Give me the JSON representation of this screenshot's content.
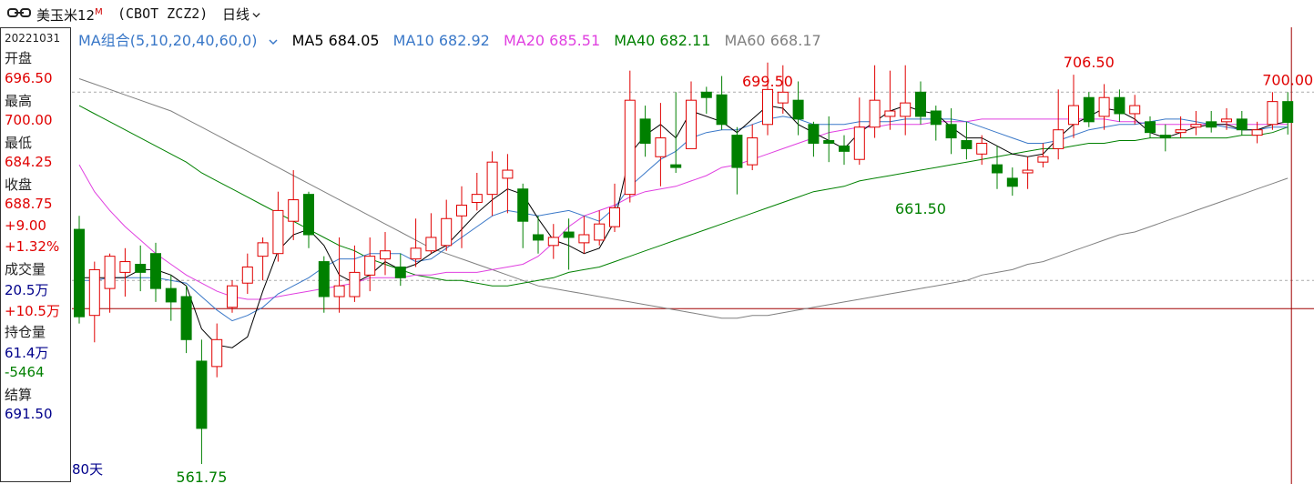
{
  "header": {
    "symbol_name": "美玉米12",
    "symbol_badge": "M",
    "code": "(CBOT ZCZ2)",
    "period_label": "日线"
  },
  "info": {
    "date": "20221031",
    "open_label": "开盘",
    "open": "696.50",
    "high_label": "最高",
    "high": "700.00",
    "low_label": "最低",
    "low": "684.25",
    "close_label": "收盘",
    "close": "688.75",
    "change": "+9.00",
    "change_pct": "+1.32%",
    "volume_label": "成交量",
    "volume": "20.5万",
    "volume_change": "+10.5万",
    "oi_label": "持仓量",
    "oi": "61.4万",
    "oi_change": "-5464",
    "settle_label": "结算",
    "settle": "691.50"
  },
  "legend": {
    "group": "MA组合(5,10,20,40,60,0)",
    "ma5": "MA5 684.05",
    "ma10": "MA10 682.92",
    "ma20": "MA20 685.51",
    "ma40": "MA40 682.11",
    "ma60": "MA60 668.17"
  },
  "days_label": "80天",
  "colors": {
    "up": "#e00000",
    "down": "#008000",
    "ma5": "#000000",
    "ma10": "#3a78c8",
    "ma20": "#e040e0",
    "ma40": "#008000",
    "ma60": "#808080",
    "crosshair": "#a00000",
    "grid": "#aaaaaa"
  },
  "chart_data": {
    "type": "candlestick",
    "ylim": [
      555,
      716
    ],
    "grid_levels": [
      700,
      630
    ],
    "crosshair_price": 619.5,
    "annotations": [
      {
        "text": "699.50",
        "bar": 45,
        "value": 699.5,
        "pos": "above",
        "color": "up"
      },
      {
        "text": "706.50",
        "bar": 66,
        "value": 706.5,
        "pos": "above",
        "color": "up"
      },
      {
        "text": "700.00",
        "bar": 79,
        "value": 700.0,
        "pos": "above",
        "color": "up"
      },
      {
        "text": "661.50",
        "bar": 55,
        "value": 661.5,
        "pos": "below",
        "color": "down"
      },
      {
        "text": "561.75",
        "bar": 8,
        "value": 561.75,
        "pos": "below",
        "color": "down"
      }
    ],
    "candles": [
      [
        649.0,
        616.5,
        654.0,
        614.0
      ],
      [
        617.0,
        634.0,
        637.0,
        607.0
      ],
      [
        627.0,
        639.0,
        640.0,
        618.0
      ],
      [
        633.0,
        637.0,
        642.0,
        624.0
      ],
      [
        636.0,
        633.0,
        643.0,
        626.0
      ],
      [
        640.0,
        627.0,
        644.0,
        622.0
      ],
      [
        627.0,
        622.0,
        632.0,
        615.0
      ],
      [
        624.0,
        608.0,
        628.0,
        603.0
      ],
      [
        600.0,
        575.0,
        608.0,
        561.75
      ],
      [
        598.0,
        608.0,
        614.0,
        594.0
      ],
      [
        620.0,
        628.0,
        630.0,
        618.0
      ],
      [
        629.0,
        635.0,
        640.0,
        625.0
      ],
      [
        639.0,
        644.0,
        646.0,
        630.0
      ],
      [
        640.0,
        656.0,
        663.0,
        637.0
      ],
      [
        652.0,
        660.0,
        671.0,
        645.0
      ],
      [
        662.0,
        647.0,
        663.0,
        642.0
      ],
      [
        637.0,
        624.0,
        639.0,
        618.0
      ],
      [
        624.0,
        628.0,
        646.0,
        618.0
      ],
      [
        624.0,
        633.0,
        643.0,
        622.0
      ],
      [
        632.0,
        639.0,
        646.0,
        626.0
      ],
      [
        638.0,
        641.0,
        648.0,
        632.0
      ],
      [
        635.0,
        631.0,
        640.0,
        628.0
      ],
      [
        638.0,
        642.0,
        653.0,
        635.0
      ],
      [
        641.0,
        646.0,
        655.0,
        640.0
      ],
      [
        643.0,
        653.0,
        660.0,
        641.0
      ],
      [
        654.0,
        658.0,
        665.0,
        642.0
      ],
      [
        659.0,
        662.0,
        670.0,
        656.0
      ],
      [
        662.0,
        674.0,
        678.0,
        654.0
      ],
      [
        668.0,
        671.0,
        677.0,
        655.0
      ],
      [
        664.0,
        652.0,
        666.0,
        642.0
      ],
      [
        647.0,
        645.0,
        654.0,
        640.0
      ],
      [
        643.0,
        646.0,
        651.0,
        638.0
      ],
      [
        648.0,
        646.0,
        653.0,
        634.0
      ],
      [
        644.0,
        647.0,
        654.0,
        640.0
      ],
      [
        645.0,
        651.0,
        656.0,
        643.0
      ],
      [
        650.0,
        657.0,
        666.0,
        648.0
      ],
      [
        662.0,
        697.0,
        708.0,
        659.0
      ],
      [
        690.0,
        681.0,
        695.0,
        676.0
      ],
      [
        676.0,
        683.0,
        696.0,
        665.0
      ],
      [
        673.0,
        672.0,
        700.0,
        670.0
      ],
      [
        679.0,
        697.0,
        704.0,
        679.0
      ],
      [
        700.0,
        698.0,
        702.0,
        692.0
      ],
      [
        699.0,
        688.0,
        706.0,
        686.0
      ],
      [
        684.0,
        672.0,
        687.0,
        662.0
      ],
      [
        673.0,
        683.0,
        688.0,
        671.0
      ],
      [
        688.0,
        701.0,
        711.0,
        684.0
      ],
      [
        696.0,
        700.0,
        710.0,
        692.0
      ],
      [
        697.0,
        690.0,
        704.0,
        684.0
      ],
      [
        688.0,
        681.0,
        689.0,
        676.0
      ],
      [
        682.0,
        681.0,
        691.0,
        674.0
      ],
      [
        680.0,
        678.0,
        684.0,
        673.0
      ],
      [
        675.0,
        687.0,
        698.0,
        673.0
      ],
      [
        687.0,
        697.0,
        710.0,
        683.0
      ],
      [
        691.0,
        693.0,
        708.0,
        686.0
      ],
      [
        691.0,
        696.0,
        710.0,
        684.0
      ],
      [
        700.0,
        691.0,
        704.0,
        688.0
      ],
      [
        693.0,
        688.0,
        695.0,
        682.0
      ],
      [
        688.0,
        683.0,
        694.0,
        677.0
      ],
      [
        682.0,
        679.0,
        689.0,
        675.0
      ],
      [
        677.0,
        681.0,
        684.0,
        673.0
      ],
      [
        673.0,
        670.0,
        680.0,
        664.0
      ],
      [
        668.0,
        665.0,
        672.0,
        661.5
      ],
      [
        670.0,
        671.0,
        676.0,
        664.0
      ],
      [
        674.0,
        676.0,
        681.0,
        672.0
      ],
      [
        679.0,
        686.0,
        701.0,
        675.0
      ],
      [
        688.0,
        695.0,
        706.5,
        683.0
      ],
      [
        698.0,
        689.0,
        700.0,
        687.0
      ],
      [
        691.0,
        698.0,
        703.0,
        686.0
      ],
      [
        698.0,
        692.0,
        701.0,
        689.0
      ],
      [
        692.0,
        695.0,
        699.0,
        688.0
      ],
      [
        689.0,
        685.0,
        691.0,
        683.0
      ],
      [
        684.0,
        683.0,
        688.0,
        678.0
      ],
      [
        685.0,
        686.0,
        691.0,
        683.0
      ],
      [
        687.0,
        688.0,
        693.0,
        684.0
      ],
      [
        689.0,
        687.0,
        693.0,
        685.0
      ],
      [
        689.0,
        690.0,
        694.0,
        686.0
      ],
      [
        690.0,
        686.0,
        693.0,
        684.0
      ],
      [
        684.0,
        686.0,
        689.0,
        681.0
      ],
      [
        688.0,
        696.5,
        700.0,
        686.0
      ],
      [
        696.5,
        688.75,
        700.0,
        684.25
      ]
    ],
    "ma": {
      "ma5": [
        631.0,
        631.0,
        631.0,
        631.0,
        634.0,
        634.0,
        632.0,
        628.0,
        612.0,
        606.0,
        605.0,
        609.0,
        626.0,
        641.0,
        647.0,
        649.0,
        643.0,
        632.0,
        629.0,
        632.0,
        637.0,
        634.0,
        636.0,
        640.0,
        643.0,
        649.0,
        655.0,
        660.0,
        664.0,
        662.0,
        653.0,
        645.0,
        643.0,
        640.0,
        642.0,
        652.0,
        677.0,
        684.0,
        688.0,
        683.0,
        693.0,
        691.0,
        689.0,
        685.0,
        690.0,
        695.0,
        694.0,
        688.0,
        685.0,
        682.0,
        679.0,
        685.0,
        689.0,
        693.0,
        695.0,
        693.0,
        692.0,
        687.0,
        683.0,
        683.0,
        680.0,
        677.0,
        676.0,
        677.0,
        683.0,
        688.0,
        691.0,
        694.0,
        693.0,
        690.0,
        685.0,
        683.0,
        685.0,
        687.0,
        688.0,
        688.0,
        686.0,
        686.0,
        688.0,
        689.0
      ],
      "ma10": [
        630.0,
        630.0,
        631.0,
        631.0,
        631.0,
        631.0,
        630.0,
        629.0,
        624.0,
        619.0,
        615.0,
        617.0,
        620.0,
        625.0,
        628.0,
        631.0,
        635.0,
        638.0,
        638.0,
        640.0,
        640.0,
        640.0,
        637.0,
        638.0,
        642.0,
        646.0,
        650.0,
        654.0,
        656.0,
        655.0,
        654.0,
        655.0,
        656.0,
        654.0,
        652.0,
        657.0,
        665.0,
        670.0,
        675.0,
        678.0,
        683.0,
        685.0,
        686.0,
        686.0,
        688.0,
        690.0,
        691.0,
        690.0,
        688.0,
        688.0,
        688.0,
        689.0,
        689.0,
        689.0,
        690.0,
        690.0,
        690.0,
        690.0,
        689.0,
        687.0,
        685.0,
        683.0,
        681.0,
        681.0,
        682.0,
        684.0,
        686.0,
        687.0,
        688.0,
        688.0,
        689.0,
        690.0,
        690.0,
        689.0,
        688.0,
        687.0,
        686.0,
        686.0,
        687.0,
        687.0
      ],
      "ma20": [
        673.0,
        663.0,
        656.0,
        650.0,
        645.0,
        640.0,
        636.0,
        632.0,
        629.0,
        626.0,
        624.0,
        623.0,
        623.0,
        624.0,
        625.0,
        626.0,
        627.0,
        628.0,
        629.0,
        631.0,
        631.0,
        631.0,
        632.0,
        632.0,
        633.0,
        633.0,
        633.0,
        634.0,
        635.0,
        636.0,
        639.0,
        644.0,
        650.0,
        654.0,
        656.0,
        658.0,
        661.0,
        663.0,
        664.0,
        665.0,
        667.0,
        669.0,
        672.0,
        673.0,
        675.0,
        677.0,
        679.0,
        681.0,
        683.0,
        685.0,
        686.0,
        687.0,
        687.0,
        688.0,
        688.0,
        688.0,
        689.0,
        689.0,
        689.0,
        690.0,
        690.0,
        690.0,
        690.0,
        690.0,
        690.0,
        690.0,
        690.0,
        690.0,
        689.0,
        689.0,
        688.0,
        688.0,
        688.0,
        688.0,
        688.0,
        688.0,
        688.0,
        688.0,
        688.0,
        688.0
      ],
      "ma40": [
        695.0,
        692.0,
        689.0,
        686.0,
        683.0,
        680.0,
        677.0,
        674.0,
        670.0,
        667.0,
        664.0,
        661.0,
        658.0,
        655.0,
        652.0,
        649.0,
        646.0,
        643.0,
        641.0,
        638.0,
        636.0,
        634.0,
        632.0,
        631.0,
        630.0,
        630.0,
        629.0,
        628.0,
        628.0,
        629.0,
        630.0,
        631.0,
        633.0,
        634.0,
        635.0,
        637.0,
        639.0,
        641.0,
        643.0,
        645.0,
        647.0,
        649.0,
        651.0,
        653.0,
        655.0,
        657.0,
        659.0,
        661.0,
        663.0,
        664.0,
        665.0,
        667.0,
        668.0,
        669.0,
        670.0,
        671.0,
        672.0,
        673.0,
        674.0,
        675.0,
        676.0,
        677.0,
        678.0,
        679.0,
        679.0,
        680.0,
        681.0,
        681.0,
        682.0,
        682.0,
        683.0,
        683.0,
        683.0,
        683.0,
        683.0,
        683.0,
        684.0,
        684.0,
        685.0,
        687.0
      ],
      "ma60": [
        705.0,
        703.0,
        701.0,
        699.0,
        697.0,
        695.0,
        693.0,
        690.0,
        687.0,
        684.0,
        681.0,
        678.0,
        675.0,
        672.0,
        669.0,
        666.0,
        663.0,
        660.0,
        657.0,
        654.0,
        651.0,
        648.0,
        645.0,
        642.0,
        640.0,
        638.0,
        636.0,
        634.0,
        632.0,
        630.0,
        628.0,
        627.0,
        626.0,
        625.0,
        624.0,
        623.0,
        622.0,
        621.0,
        620.0,
        619.0,
        618.0,
        617.0,
        616.0,
        616.0,
        617.0,
        617.0,
        618.0,
        619.0,
        620.0,
        621.0,
        622.0,
        623.0,
        624.0,
        625.0,
        626.0,
        627.0,
        628.0,
        629.0,
        630.0,
        632.0,
        633.0,
        634.0,
        636.0,
        637.0,
        639.0,
        641.0,
        643.0,
        645.0,
        647.0,
        648.0,
        650.0,
        652.0,
        654.0,
        656.0,
        658.0,
        660.0,
        662.0,
        664.0,
        666.0,
        668.0
      ]
    }
  }
}
